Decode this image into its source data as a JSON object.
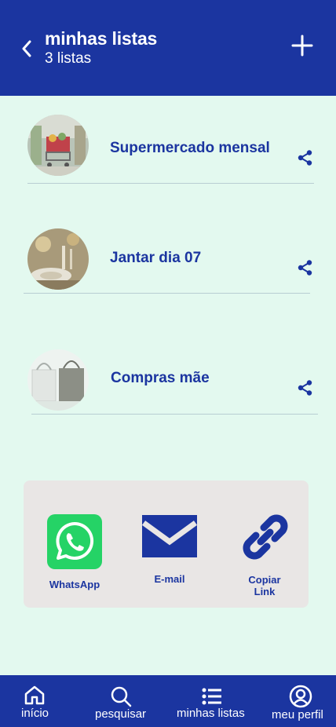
{
  "header": {
    "title": "minhas listas",
    "subtitle": "3 listas",
    "back_icon": "chevron-left-icon",
    "add_icon": "plus-icon"
  },
  "lists": [
    {
      "name": "Supermercado mensal",
      "thumbnail": "supermarket-cart-photo",
      "share_icon": "share-icon"
    },
    {
      "name": "Jantar dia 07",
      "thumbnail": "dinner-table-photo",
      "share_icon": "share-icon"
    },
    {
      "name": "Compras mãe",
      "thumbnail": "shopping-bags-photo",
      "share_icon": "share-icon"
    }
  ],
  "share_options": [
    {
      "label": "WhatsApp",
      "icon": "whatsapp-icon",
      "color": "#25d366"
    },
    {
      "label": "E-mail",
      "icon": "envelope-icon",
      "color": "#1b35a0"
    },
    {
      "label": "Copiar\nLink",
      "icon": "link-icon",
      "color": "#1b35a0"
    }
  ],
  "bottom_nav": [
    {
      "label": "início",
      "icon": "home-icon"
    },
    {
      "label": "pesquisar",
      "icon": "search-icon"
    },
    {
      "label": "minhas listas",
      "icon": "list-icon"
    },
    {
      "label": "meu perfil",
      "icon": "user-circle-icon"
    }
  ],
  "colors": {
    "primary": "#1b35a0",
    "background": "#e3f9ef",
    "panel": "#e9e6e5",
    "whatsapp": "#25d366"
  }
}
